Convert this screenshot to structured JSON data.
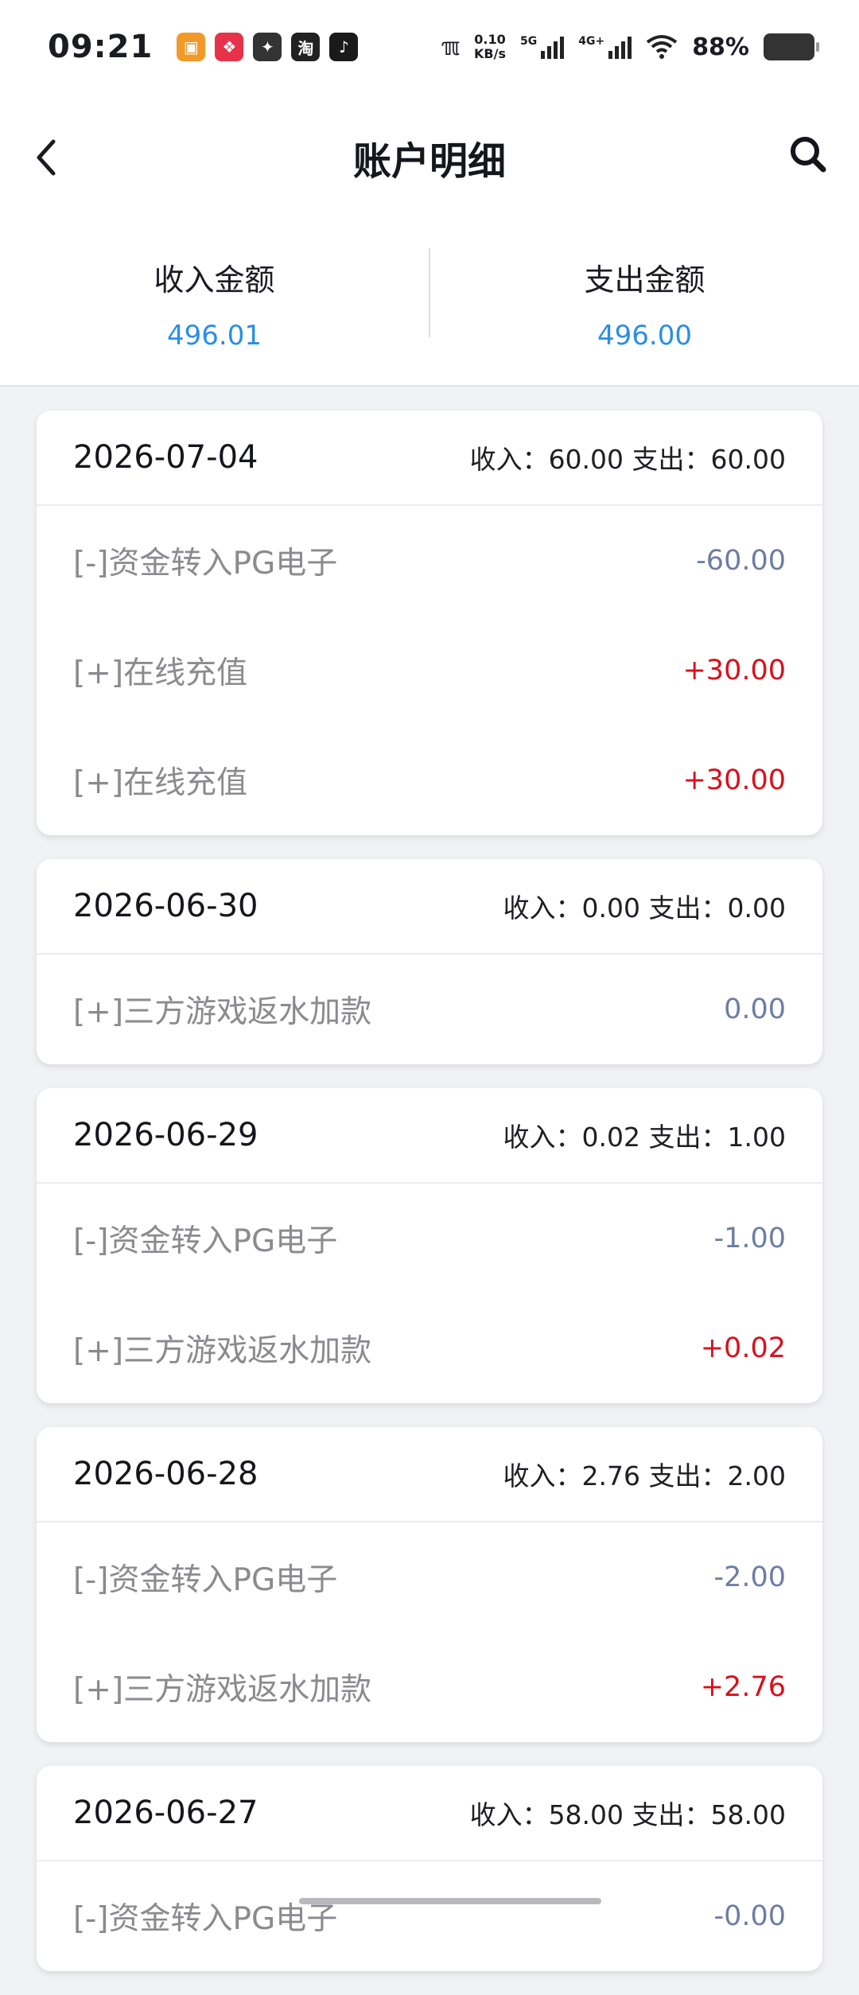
{
  "status_bar": {
    "time": "09:21",
    "app_icons": [
      {
        "name": "shop-app-icon",
        "color": "#f19a2a",
        "glyph": "▣"
      },
      {
        "name": "pdd-app-icon",
        "color": "#e8324a",
        "glyph": "❖"
      },
      {
        "name": "wechat-app-icon",
        "color": "#333333",
        "glyph": "✦"
      },
      {
        "name": "taobao-app-icon",
        "color": "#222222",
        "glyph": "淘"
      },
      {
        "name": "tiktok-app-icon",
        "color": "#1a1a1a",
        "glyph": "♪"
      }
    ],
    "net_speed_value": "0.10",
    "net_speed_unit": "KB/s",
    "signal_1_label": "5G",
    "signal_2_label": "4G+",
    "battery": "88%"
  },
  "header": {
    "title": "账户明细"
  },
  "summary": {
    "income_label": "收入金额",
    "income_value": "496.01",
    "expense_label": "支出金额",
    "expense_value": "496.00"
  },
  "colors": {
    "accent_blue": "#2a8ee6",
    "income_red": "#d9101c",
    "expense_grey_blue": "#6d7da3"
  },
  "days": [
    {
      "date": "2026-07-04",
      "summary": "收入：60.00 支出：60.00",
      "entries": [
        {
          "name": "[-]资金转入PG电子",
          "amount": "-60.00",
          "type": "out"
        },
        {
          "name": "[+]在线充值",
          "amount": "+30.00",
          "type": "in"
        },
        {
          "name": "[+]在线充值",
          "amount": "+30.00",
          "type": "in"
        }
      ]
    },
    {
      "date": "2026-06-30",
      "summary": "收入：0.00 支出：0.00",
      "entries": [
        {
          "name": "[+]三方游戏返水加款",
          "amount": "0.00",
          "type": "zero"
        }
      ]
    },
    {
      "date": "2026-06-29",
      "summary": "收入：0.02 支出：1.00",
      "entries": [
        {
          "name": "[-]资金转入PG电子",
          "amount": "-1.00",
          "type": "out"
        },
        {
          "name": "[+]三方游戏返水加款",
          "amount": "+0.02",
          "type": "in"
        }
      ]
    },
    {
      "date": "2026-06-28",
      "summary": "收入：2.76 支出：2.00",
      "entries": [
        {
          "name": "[-]资金转入PG电子",
          "amount": "-2.00",
          "type": "out"
        },
        {
          "name": "[+]三方游戏返水加款",
          "amount": "+2.76",
          "type": "in"
        }
      ]
    },
    {
      "date": "2026-06-27",
      "summary": "收入：58.00 支出：58.00",
      "entries": [
        {
          "name": "[-]资金转入PG电子",
          "amount": "-0.00",
          "type": "out"
        }
      ]
    }
  ]
}
